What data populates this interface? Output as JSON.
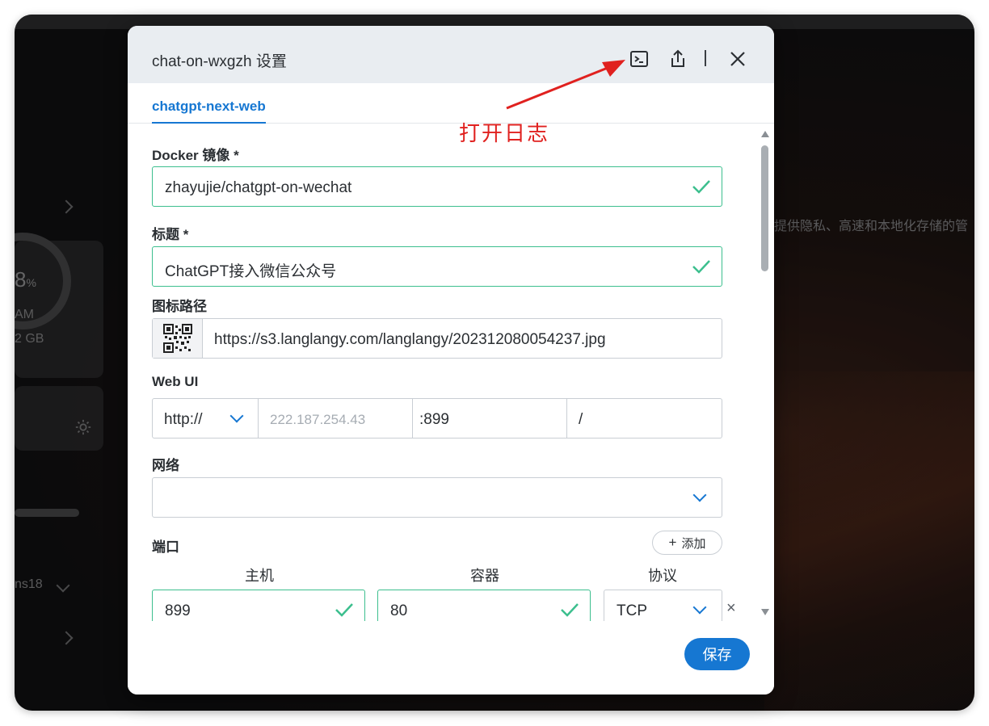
{
  "background": {
    "frag_text_1": "提供隐私、高速和本地化存储的管",
    "frag_pct": "8",
    "frag_pct_unit": "%",
    "frag_am": "AM",
    "frag_gb": "2 GB",
    "frag_ns": "ns18"
  },
  "dialog": {
    "title": "chat-on-wxgzh 设置",
    "tab_label": "chatgpt-next-web",
    "annotation": "打开日志",
    "annotation_color": "#e0211f",
    "accent_color": "#1677d2",
    "valid_color": "#3cbf8e"
  },
  "form": {
    "image_label": "Docker 镜像 *",
    "image_value": "zhayujie/chatgpt-on-wechat",
    "title_label": "标题 *",
    "title_value": "ChatGPT接入微信公众号",
    "icon_label": "图标路径",
    "icon_value": "https://s3.langlangy.com/langlangy/202312080054237.jpg",
    "webui_label": "Web UI",
    "webui_protocol": "http://",
    "webui_host_placeholder": "222.187.254.43",
    "webui_port": ":899",
    "webui_path": "/",
    "network_label": "网络",
    "network_value": "",
    "ports_label": "端口",
    "add_label": "添加",
    "col_host": "主机",
    "col_container": "容器",
    "col_protocol": "协议",
    "port_host": "899",
    "port_container": "80",
    "port_protocol": "TCP"
  },
  "footer": {
    "save_label": "保存"
  },
  "icons": {
    "terminal": "terminal-icon",
    "share": "share-icon",
    "close": "close-icon",
    "check": "check-icon",
    "qr": "qr-code-icon",
    "chevron": "chevron-down-icon",
    "plus": "plus-icon",
    "delete": "delete-icon"
  }
}
